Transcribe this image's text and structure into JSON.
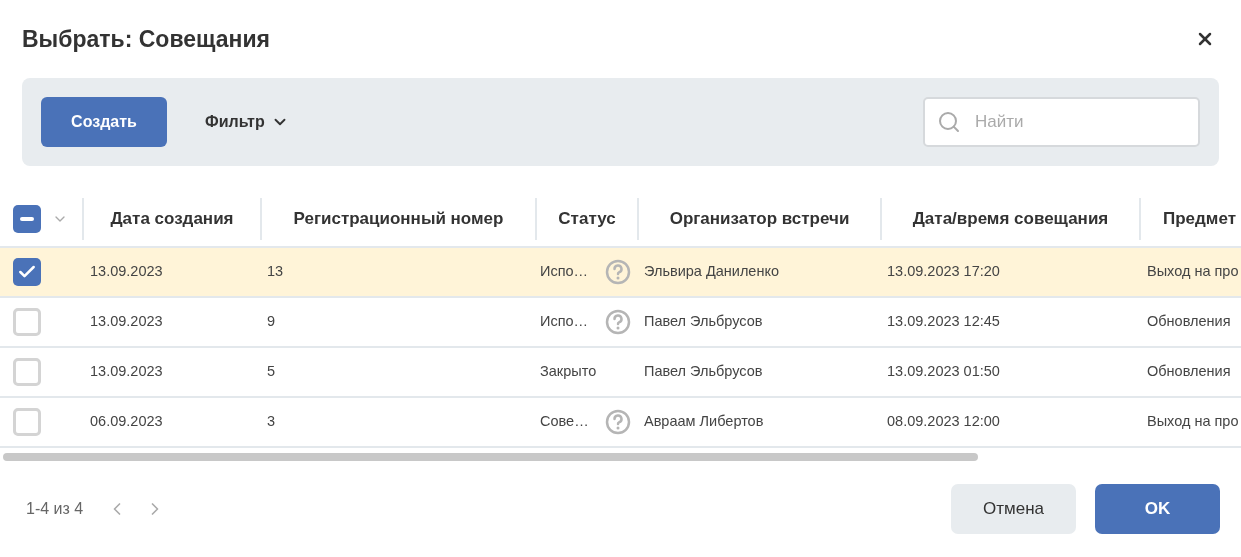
{
  "dialog": {
    "title": "Выбрать: Совещания"
  },
  "toolbar": {
    "create_button": "Создать",
    "filter_button": "Фильтр",
    "search": {
      "placeholder": "Найти"
    }
  },
  "table": {
    "select_all": {
      "indeterminate": true
    },
    "columns": [
      "Дата создания",
      "Регистрационный номер",
      "Статус",
      "Организатор встречи",
      "Дата/время совещания",
      "Предмет"
    ],
    "rows": [
      {
        "selected": true,
        "cells": [
          "13.09.2023",
          "13",
          "Испо…",
          "Эльвира Даниленко",
          "13.09.2023 17:20",
          "Выход на про"
        ],
        "status_help": true
      },
      {
        "selected": false,
        "cells": [
          "13.09.2023",
          "9",
          "Испо…",
          "Павел Эльбрусов",
          "13.09.2023 12:45",
          "Обновления"
        ],
        "status_help": true
      },
      {
        "selected": false,
        "cells": [
          "13.09.2023",
          "5",
          "Закрыто",
          "Павел Эльбрусов",
          "13.09.2023 01:50",
          "Обновления"
        ],
        "status_help": false
      },
      {
        "selected": false,
        "cells": [
          "06.09.2023",
          "3",
          "Сове…",
          "Авраам Либертов",
          "08.09.2023 12:00",
          "Выход на про"
        ],
        "status_help": true
      }
    ]
  },
  "footer": {
    "pagination": "1-4 из 4",
    "cancel_button": "Отмена",
    "ok_button": "OK"
  }
}
